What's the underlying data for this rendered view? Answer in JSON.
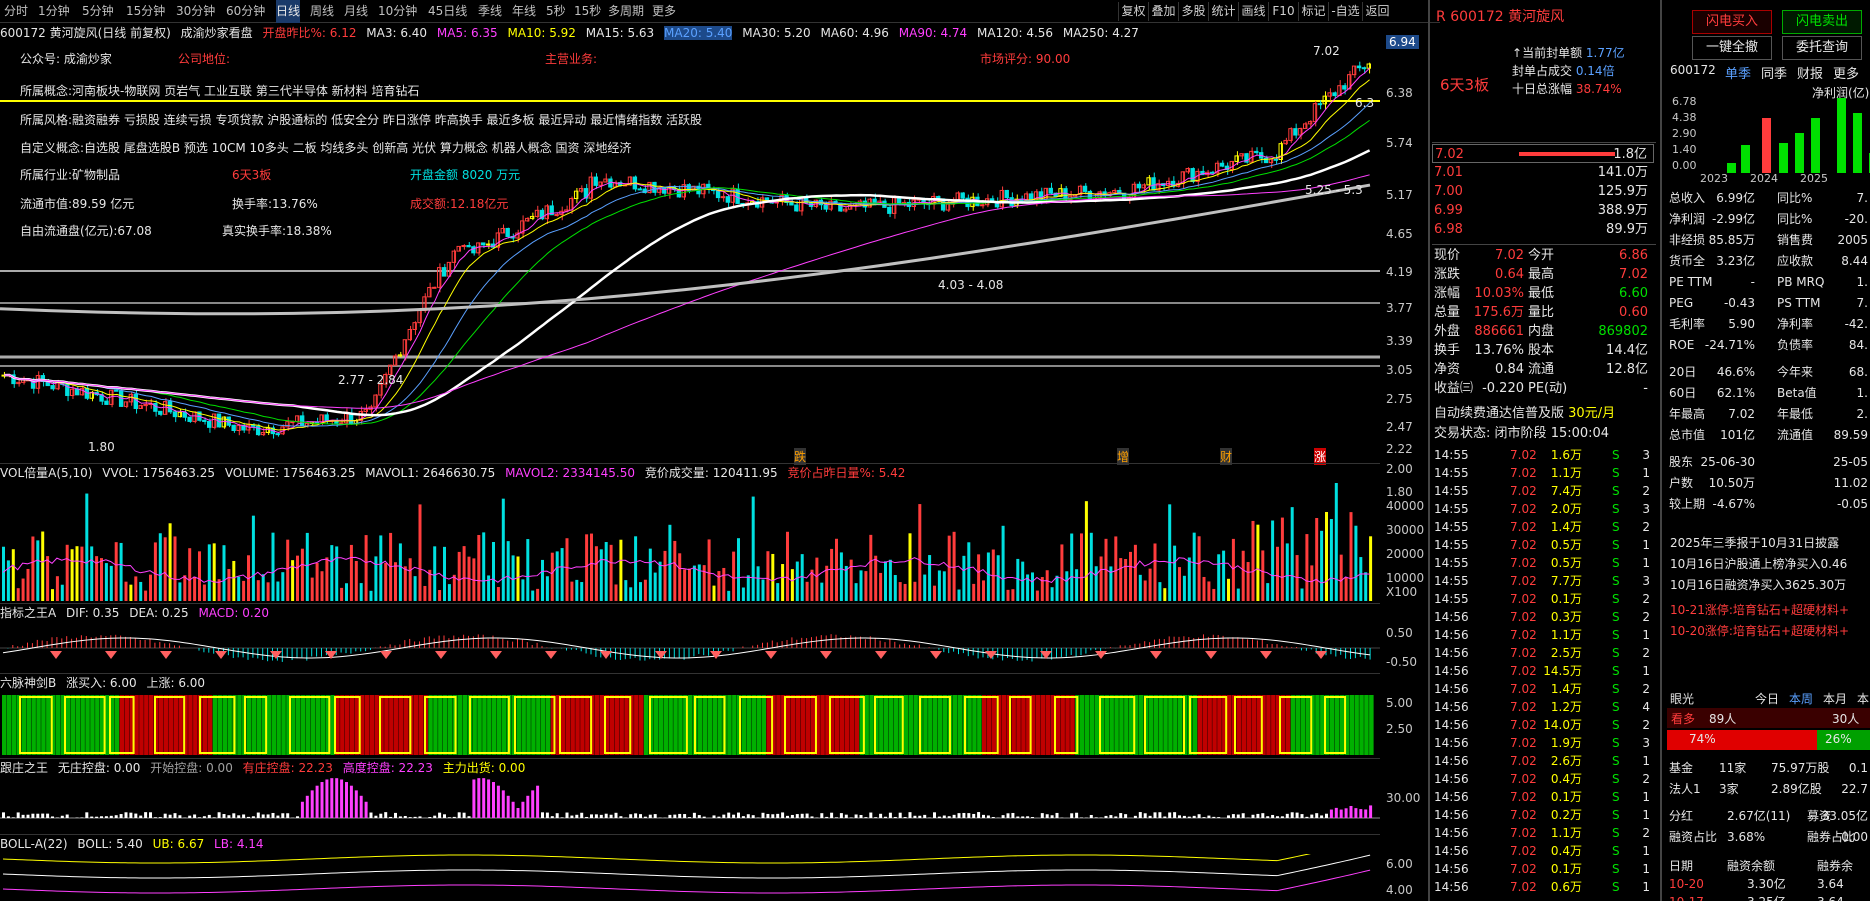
{
  "toolbar": {
    "periods": [
      "分时",
      "1分钟",
      "5分钟",
      "15分钟",
      "30分钟",
      "60分钟",
      "日线",
      "周线",
      "月线",
      "10分钟",
      "45日线",
      "季线",
      "年线",
      "5秒",
      "15秒",
      "多周期",
      "更多"
    ],
    "active_period": "日线",
    "right_buttons": [
      "复权",
      "叠加",
      "多股",
      "统计",
      "画线",
      "F10",
      "标记",
      "-自选",
      "返回"
    ]
  },
  "chart_header": {
    "stock_title": "600172 黄河旋风(日线 前复权)",
    "template": "成渝炒家看盘",
    "open_change": "开盘昨比%: 6.12",
    "ma3": "MA3: 6.40",
    "ma5": "MA5: 6.35",
    "ma10": "MA10: 5.92",
    "ma15": "MA15: 5.63",
    "ma20": "MA20: 5.40",
    "ma30": "MA30: 5.20",
    "ma60": "MA60: 4.96",
    "ma90": "MA90: 4.74",
    "ma120": "MA120: 4.56",
    "ma250": "MA250: 4.27"
  },
  "overlay": {
    "gzh": "公众号: 成渝炒家",
    "company": "公司地位:",
    "main_biz": "主营业务:",
    "score": "市场评分: 90.00",
    "concepts": "所属概念:河南板块-物联网 页岩气 工业互联 第三代半导体 新材料 培育钻石",
    "styles": "所属风格:融资融券 亏损股 连续亏损 专项贷款 沪股通标的 低安全分 昨日涨停 昨高换手 最近多板 最近异动 最近情绪指数 活跃股",
    "custom": "自定义概念:自选股 尾盘选股B 预选 10CM 10多头 二板 均线多头 创新高 光伏 算力概念 机器人概念 国资 深地经济",
    "industry": "所属行业:矿物制品",
    "boards": "6天3板",
    "open_amount": "开盘金额 8020 万元",
    "mktcap": "流通市值:89.59 亿元",
    "turnover": "换手率:13.76%",
    "amount": "成交额:12.18亿元",
    "free_cap": "自由流通盘(亿元):67.08",
    "real_turnover": "真实换手率:18.38%"
  },
  "price_axis": [
    "6.94",
    "6.38",
    "5.74",
    "5.17",
    "4.65",
    "4.19",
    "3.77",
    "3.39",
    "3.05",
    "2.75",
    "2.47",
    "2.22",
    "2.00",
    "1.80"
  ],
  "chart_labels": {
    "high": "7.02",
    "low": "1.80",
    "mid1": "2.77 - 2.84",
    "mid2": "4.03 - 4.08",
    "mid3": "6.3",
    "mid4": "5.25 - 5.3"
  },
  "markers": [
    "跌",
    "增",
    "财",
    "涨"
  ],
  "vol": {
    "title": "VOL倍量A(5,10)",
    "vvol": "VVOL: 1756463.25",
    "volume": "VOLUME: 1756463.25",
    "mavol1": "MAVOL1: 2646630.75",
    "mavol2": "MAVOL2: 2334145.50",
    "bid": "竞价成交量: 120411.95",
    "bidpct": "竞价占昨日量%: 5.42",
    "axis": [
      "40000",
      "30000",
      "20000",
      "10000",
      "X100"
    ]
  },
  "macd": {
    "title": "指标之王A",
    "dif": "DIF: 0.35",
    "dea": "DEA: 0.25",
    "macd": "MACD: 0.20",
    "axis": [
      "0.50",
      "-0.50"
    ]
  },
  "six": {
    "title": "六脉神剑B",
    "buy": "涨买入: 6.00",
    "up": "上涨: 6.00",
    "axis": [
      "5.00",
      "2.50"
    ]
  },
  "zhuang": {
    "title": "跟庄之王",
    "a": "无庄控盘: 0.00",
    "b": "开始控盘: 0.00",
    "c": "有庄控盘: 22.23",
    "d": "高度控盘: 22.23",
    "e": "主力出货: 0.00",
    "axis": [
      "30.00"
    ]
  },
  "boll": {
    "title": "BOLL-A(22)",
    "boll": "BOLL: 5.40",
    "ub": "UB: 6.67",
    "lb": "LB: 4.14",
    "axis": [
      "6.00",
      "4.00"
    ]
  },
  "quote": {
    "code": "600172",
    "name": "黄河旋风",
    "boards": "6天3板",
    "seal1_label": "当前封单额",
    "seal1": "1.77亿",
    "seal2_label": "封单占成交",
    "seal2": "0.14倍",
    "seal3_label": "十日总涨幅",
    "seal3": "38.74%",
    "bids": [
      [
        "7.02",
        "1.8亿"
      ],
      [
        "7.01",
        "141.0万"
      ],
      [
        "7.00",
        "125.9万"
      ],
      [
        "6.99",
        "388.9万"
      ],
      [
        "6.98",
        "89.9万"
      ]
    ],
    "stats": [
      [
        "现价",
        "7.02",
        "今开",
        "6.86"
      ],
      [
        "涨跌",
        "0.64",
        "最高",
        "7.02"
      ],
      [
        "涨幅",
        "10.03%",
        "最低",
        "6.60"
      ],
      [
        "总量",
        "175.6万",
        "量比",
        "0.60"
      ],
      [
        "外盘",
        "886661",
        "内盘",
        "869802"
      ],
      [
        "换手",
        "13.76%",
        "股本",
        "14.4亿"
      ],
      [
        "净资",
        "0.84",
        "流通",
        "12.8亿"
      ],
      [
        "收益㈢",
        "-0.220",
        "PE(动)",
        "-"
      ]
    ],
    "promo": "自动续费通达信普及版",
    "price_tag": "30元/月",
    "trade_state_label": "交易状态:",
    "trade_state": "闭市阶段",
    "trade_time": "15:00:04",
    "ticks": [
      [
        "14:55",
        "7.02",
        "1.6万",
        "S",
        "3"
      ],
      [
        "14:55",
        "7.02",
        "1.1万",
        "S",
        "1"
      ],
      [
        "14:55",
        "7.02",
        "7.4万",
        "S",
        "2"
      ],
      [
        "14:55",
        "7.02",
        "2.0万",
        "S",
        "3"
      ],
      [
        "14:55",
        "7.02",
        "1.4万",
        "S",
        "2"
      ],
      [
        "14:55",
        "7.02",
        "0.5万",
        "S",
        "1"
      ],
      [
        "14:55",
        "7.02",
        "0.5万",
        "S",
        "1"
      ],
      [
        "14:55",
        "7.02",
        "7.7万",
        "S",
        "3"
      ],
      [
        "14:55",
        "7.02",
        "0.1万",
        "S",
        "2"
      ],
      [
        "14:56",
        "7.02",
        "0.3万",
        "S",
        "2"
      ],
      [
        "14:56",
        "7.02",
        "1.1万",
        "S",
        "1"
      ],
      [
        "14:56",
        "7.02",
        "2.5万",
        "S",
        "2"
      ],
      [
        "14:56",
        "7.02",
        "14.5万",
        "S",
        "1"
      ],
      [
        "14:56",
        "7.02",
        "1.4万",
        "S",
        "2"
      ],
      [
        "14:56",
        "7.02",
        "1.2万",
        "S",
        "4"
      ],
      [
        "14:56",
        "7.02",
        "14.0万",
        "S",
        "2"
      ],
      [
        "14:56",
        "7.02",
        "1.9万",
        "S",
        "3"
      ],
      [
        "14:56",
        "7.02",
        "2.6万",
        "S",
        "1"
      ],
      [
        "14:56",
        "7.02",
        "0.4万",
        "S",
        "2"
      ],
      [
        "14:56",
        "7.02",
        "0.1万",
        "S",
        "1"
      ],
      [
        "14:56",
        "7.02",
        "0.2万",
        "S",
        "1"
      ],
      [
        "14:56",
        "7.02",
        "1.1万",
        "S",
        "2"
      ],
      [
        "14:56",
        "7.02",
        "0.4万",
        "S",
        "1"
      ],
      [
        "14:56",
        "7.02",
        "0.1万",
        "S",
        "1"
      ],
      [
        "14:56",
        "7.02",
        "0.6万",
        "S",
        "1"
      ]
    ]
  },
  "right": {
    "btn1": "闪电买入",
    "btn2": "闪电卖出",
    "btn3": "一键全撤",
    "btn4": "委托查询",
    "code": "600172",
    "tabs": [
      "单季",
      "同季",
      "财报",
      "更多"
    ],
    "chart_title": "净利润(亿)",
    "years": [
      "2023",
      "2024",
      "2025"
    ],
    "axis": [
      "6.78",
      "4.38",
      "2.90",
      "1.40",
      "0.00"
    ],
    "fin": [
      [
        "总收入",
        "6.99亿",
        "同比%",
        "7."
      ],
      [
        "净利润",
        "-2.99亿",
        "同比%",
        "-20."
      ],
      [
        "非经损",
        "85.85万",
        "销售费",
        "2005"
      ],
      [
        "货币全",
        "3.23亿",
        "应收款",
        "8.44"
      ],
      [
        "PE TTM",
        "-",
        "PB MRQ",
        "1."
      ],
      [
        "PEG",
        "-0.43",
        "PS TTM",
        "7."
      ],
      [
        "毛利率",
        "5.90",
        "净利率",
        "-42."
      ],
      [
        "ROE",
        "-24.71%",
        "负债率",
        "84."
      ],
      [
        "20日",
        "46.6%",
        "今年来",
        "68."
      ],
      [
        "60日",
        "62.1%",
        "Beta值",
        "1."
      ],
      [
        "年最高",
        "7.02",
        "年最低",
        "2."
      ],
      [
        "总市值",
        "101亿",
        "流通值",
        "89.59"
      ],
      [
        "股东",
        "25-06-30",
        "",
        "25-05"
      ],
      [
        "户数",
        "10.50万",
        "",
        "11.02"
      ],
      [
        "较上期",
        "-4.67%",
        "",
        "-0.05"
      ]
    ],
    "news": [
      "2025年三季报于10月31日披露",
      "10月16日沪股通上榜净买入0.46",
      "10月16日融资净买入3625.30万",
      "10-21涨停:培育钻石+超硬材料+",
      "10-20涨停:培育钻石+超硬材料+"
    ],
    "eye_label": "眼光",
    "eye_tabs": [
      "今日",
      "本周",
      "本月",
      "本"
    ],
    "bull": "看多",
    "bull_n": "89人",
    "bear_n": "30人",
    "bull_pct": "74%",
    "bear_pct": "26%",
    "inst": [
      [
        "基金",
        "11家",
        "75.97万股",
        "0.1"
      ],
      [
        "法人1",
        "3家",
        "2.89亿股",
        "22.7"
      ]
    ],
    "fin2": [
      [
        "分红",
        "2.67亿(11)",
        "募资",
        "33.05亿"
      ],
      [
        "融资占比",
        "3.68%",
        "融券占比",
        "0.00"
      ]
    ],
    "margin_head": [
      "日期",
      "融资余额",
      "融券余"
    ],
    "margin": [
      [
        "10-20",
        "3.30亿",
        "3.64"
      ],
      [
        "10-17",
        "3.25亿",
        "3.64"
      ]
    ]
  }
}
